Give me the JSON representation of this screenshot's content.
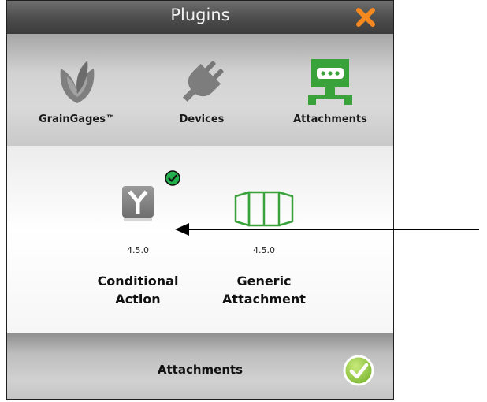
{
  "dialog": {
    "title": "Plugins",
    "accent_color": "#f5891f"
  },
  "toolbar": {
    "items": [
      {
        "label": "GrainGages™",
        "icon": "leaf-icon"
      },
      {
        "label": "Devices",
        "icon": "plug-icon"
      },
      {
        "label": "Attachments",
        "icon": "attachment-monitor-icon",
        "color": "#3aa23a"
      }
    ]
  },
  "plugins": [
    {
      "version": "4.5.0",
      "name_line1": "Conditional",
      "name_line2": "Action",
      "icon": "conditional-branch-icon",
      "installed": true
    },
    {
      "version": "4.5.0",
      "name_line1": "Generic",
      "name_line2": "Attachment",
      "icon": "bin-attachment-icon",
      "installed": false
    }
  ],
  "footer": {
    "title": "Attachments",
    "confirm_icon": "checkmark-circle-icon",
    "confirm_color": "#8cc63f"
  }
}
